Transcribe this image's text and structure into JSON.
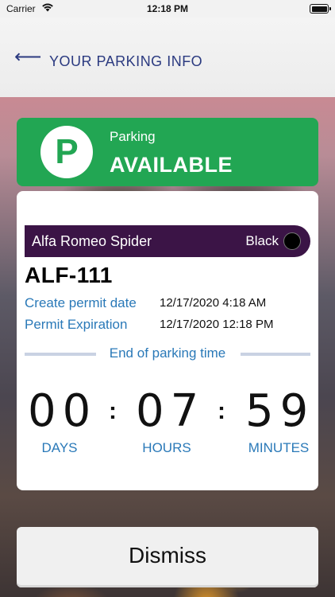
{
  "status_bar": {
    "carrier": "Carrier",
    "time": "12:18 PM"
  },
  "nav": {
    "title": "YOUR PARKING INFO",
    "back_icon": "arrow-left-icon"
  },
  "parking_status": {
    "icon_letter": "P",
    "label": "Parking",
    "value": "AVAILABLE",
    "color": "#22a653"
  },
  "vehicle": {
    "name": "Alfa Romeo Spider",
    "color_name": "Black",
    "color_swatch": "#000000",
    "plate": "ALF-111",
    "bar_color": "#3b1446"
  },
  "permit": {
    "create_label": "Create permit date",
    "create_value": "12/17/2020 4:18 AM",
    "expiration_label": "Permit Expiration",
    "expiration_value": "12/17/2020 12:18 PM"
  },
  "countdown": {
    "heading": "End of parking time",
    "days": "00",
    "hours": "07",
    "minutes": "59",
    "days_label": "DAYS",
    "hours_label": "HOURS",
    "minutes_label": "MINUTES"
  },
  "dismiss_label": "Dismiss"
}
